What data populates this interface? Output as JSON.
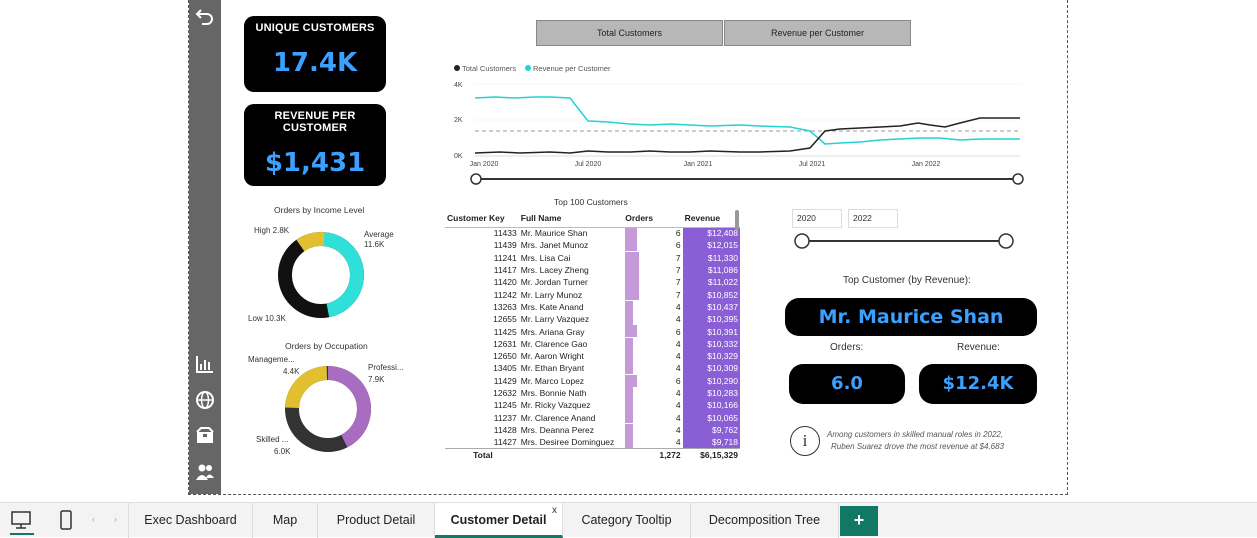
{
  "nav": {
    "back_icon": "back-arrow-icon",
    "items": [
      "bar-chart-icon",
      "globe-icon",
      "box-icon",
      "people-icon"
    ]
  },
  "kpis": {
    "unique_customers": {
      "title": "UNIQUE CUSTOMERS",
      "value": "17.4K"
    },
    "revenue_per_customer": {
      "title": "REVENUE PER CUSTOMER",
      "value": "$1,431"
    }
  },
  "toggles": {
    "total_customers": "Total Customers",
    "revenue_per_customer": "Revenue per Customer"
  },
  "line_chart": {
    "legend": [
      "Total Customers",
      "Revenue per Customer"
    ],
    "y_ticks": [
      "4K",
      "2K",
      "0K"
    ],
    "x_ticks": [
      "Jan 2020",
      "Jul 2020",
      "Jan 2021",
      "Jul 2021",
      "Jan 2022"
    ],
    "colors": {
      "total": "#222222",
      "revenue": "#22d3d3"
    }
  },
  "income_donut": {
    "title": "Orders by Income Level",
    "labels": {
      "high": "High 2.8K",
      "average": "Average",
      "average_value": "11.6K",
      "low": "Low 10.3K"
    },
    "colors": {
      "high": "#e0c030",
      "average": "#2ee0d8",
      "low": "#111111"
    }
  },
  "occupation_donut": {
    "title": "Orders by Occupation",
    "labels": {
      "management": "Manageme...",
      "management_value": "4.4K",
      "professional": "Professi...",
      "professional_value": "7.9K",
      "skilled": "Skilled ...",
      "skilled_value": "6.0K"
    },
    "colors": {
      "management": "#e0c030",
      "professional": "#a86cc0",
      "skilled": "#333333"
    }
  },
  "table": {
    "title": "Top 100 Customers",
    "headers": {
      "key": "Customer Key",
      "name": "Full Name",
      "orders": "Orders",
      "revenue": "Revenue"
    },
    "rows": [
      {
        "key": "11433",
        "name": "Mr. Maurice Shan",
        "orders": "6",
        "orders_n": 6,
        "revenue": "$12,408"
      },
      {
        "key": "11439",
        "name": "Mrs. Janet Munoz",
        "orders": "6",
        "orders_n": 6,
        "revenue": "$12,015"
      },
      {
        "key": "11241",
        "name": "Mrs. Lisa Cai",
        "orders": "7",
        "orders_n": 7,
        "revenue": "$11,330"
      },
      {
        "key": "11417",
        "name": "Mrs. Lacey Zheng",
        "orders": "7",
        "orders_n": 7,
        "revenue": "$11,086"
      },
      {
        "key": "11420",
        "name": "Mr. Jordan Turner",
        "orders": "7",
        "orders_n": 7,
        "revenue": "$11,022"
      },
      {
        "key": "11242",
        "name": "Mr. Larry Munoz",
        "orders": "7",
        "orders_n": 7,
        "revenue": "$10,852"
      },
      {
        "key": "13263",
        "name": "Mrs. Kate Anand",
        "orders": "4",
        "orders_n": 4,
        "revenue": "$10,437"
      },
      {
        "key": "12655",
        "name": "Mr. Larry Vazquez",
        "orders": "4",
        "orders_n": 4,
        "revenue": "$10,395"
      },
      {
        "key": "11425",
        "name": "Mrs. Ariana Gray",
        "orders": "6",
        "orders_n": 6,
        "revenue": "$10,391"
      },
      {
        "key": "12631",
        "name": "Mr. Clarence Gao",
        "orders": "4",
        "orders_n": 4,
        "revenue": "$10,332"
      },
      {
        "key": "12650",
        "name": "Mr. Aaron Wright",
        "orders": "4",
        "orders_n": 4,
        "revenue": "$10,329"
      },
      {
        "key": "13405",
        "name": "Mr. Ethan Bryant",
        "orders": "4",
        "orders_n": 4,
        "revenue": "$10,309"
      },
      {
        "key": "11429",
        "name": "Mr. Marco Lopez",
        "orders": "6",
        "orders_n": 6,
        "revenue": "$10,290"
      },
      {
        "key": "12632",
        "name": "Mrs. Bonnie Nath",
        "orders": "4",
        "orders_n": 4,
        "revenue": "$10,283"
      },
      {
        "key": "11245",
        "name": "Mr. Ricky Vazquez",
        "orders": "4",
        "orders_n": 4,
        "revenue": "$10,166"
      },
      {
        "key": "11237",
        "name": "Mr. Clarence Anand",
        "orders": "4",
        "orders_n": 4,
        "revenue": "$10,065"
      },
      {
        "key": "11428",
        "name": "Mrs. Deanna Perez",
        "orders": "4",
        "orders_n": 4,
        "revenue": "$9,762"
      },
      {
        "key": "11427",
        "name": "Mrs. Desiree Dominguez",
        "orders": "4",
        "orders_n": 4,
        "revenue": "$9,718"
      }
    ],
    "total": {
      "label": "Total",
      "orders": "1,272",
      "revenue": "$6,15,329"
    }
  },
  "year_filter": {
    "start": "2020",
    "end": "2022"
  },
  "top_customer": {
    "label": "Top Customer (by Revenue):",
    "name": "Mr. Maurice Shan",
    "orders_label": "Orders:",
    "orders_value": "6.0",
    "revenue_label": "Revenue:",
    "revenue_value": "$12.4K"
  },
  "insight": {
    "icon": "info-icon",
    "text_line1": "Among customers in skilled manual roles in 2022,",
    "text_line2": "Ruben Suarez drove the most revenue at $4,683"
  },
  "tabs": [
    {
      "label": "Exec Dashboard",
      "active": false
    },
    {
      "label": "Map",
      "active": false
    },
    {
      "label": "Product Detail",
      "active": false
    },
    {
      "label": "Customer Detail",
      "active": true
    },
    {
      "label": "Category Tooltip",
      "active": false
    },
    {
      "label": "Decomposition Tree",
      "active": false
    }
  ],
  "tab_close": "x",
  "add_tab": "+"
}
